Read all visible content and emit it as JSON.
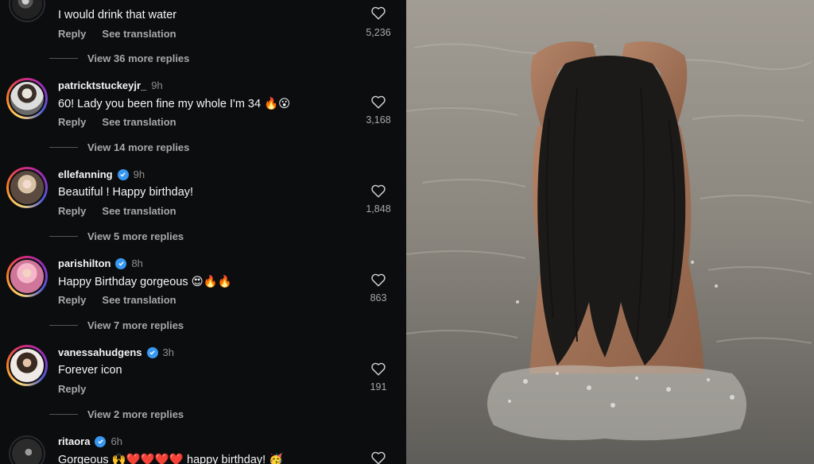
{
  "comments": [
    {
      "username": "",
      "time": "",
      "text": "I would drink that water",
      "reply": "Reply",
      "see_translation": "See translation",
      "likes": "5,236",
      "view_replies": "View 36 more replies"
    },
    {
      "username": "patricktstuckeyjr_",
      "time": "9h",
      "text": "60! Lady you been fine my whole I'm 34 🔥😮",
      "reply": "Reply",
      "see_translation": "See translation",
      "likes": "3,168",
      "view_replies": "View 14 more replies"
    },
    {
      "username": "ellefanning",
      "time": "9h",
      "text": "Beautiful ! Happy birthday!",
      "reply": "Reply",
      "see_translation": "See translation",
      "likes": "1,848",
      "view_replies": "View 5 more replies"
    },
    {
      "username": "parishilton",
      "time": "8h",
      "text": "Happy Birthday gorgeous 😍🔥🔥",
      "reply": "Reply",
      "see_translation": "See translation",
      "likes": "863",
      "view_replies": "View 7 more replies"
    },
    {
      "username": "vanessahudgens",
      "time": "3h",
      "text": "Forever icon",
      "reply": "Reply",
      "likes": "191",
      "view_replies": "View 2 more replies"
    },
    {
      "username": "ritaora",
      "time": "6h",
      "text": "Gorgeous 🙌❤️❤️❤️❤️ happy birthday! 🥳"
    }
  ],
  "icons": {
    "like": "heart-outline-icon",
    "verified": "verified-badge-icon"
  },
  "colors": {
    "panel_bg": "#0c0d0f",
    "verified": "#3897f0",
    "text_primary": "#f5f5f5",
    "text_secondary": "#a8a8a8"
  }
}
